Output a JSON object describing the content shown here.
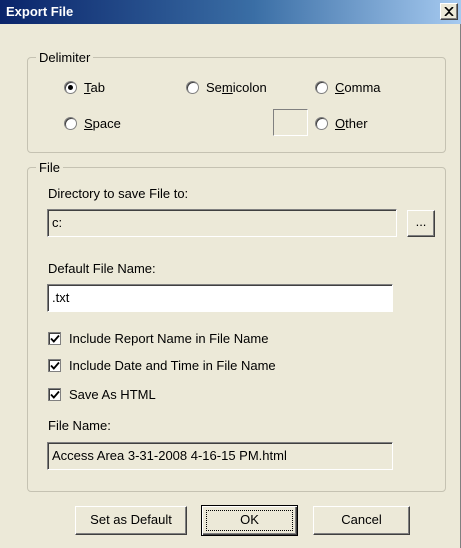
{
  "window": {
    "title": "Export File",
    "close_glyph": "X"
  },
  "delimiter": {
    "legend": "Delimiter",
    "options": [
      {
        "id": "tab",
        "pre": "",
        "accel": "T",
        "post": "ab",
        "selected": true
      },
      {
        "id": "semicolon",
        "pre": "Se",
        "accel": "m",
        "post": "icolon",
        "selected": false
      },
      {
        "id": "comma",
        "pre": "",
        "accel": "C",
        "post": "omma",
        "selected": false
      },
      {
        "id": "space",
        "pre": "",
        "accel": "S",
        "post": "pace",
        "selected": false
      },
      {
        "id": "other",
        "pre": "",
        "accel": "O",
        "post": "ther",
        "selected": false
      }
    ],
    "other_value": ""
  },
  "file": {
    "legend": "File",
    "directory_label": "Directory to save File to:",
    "directory_value": "c:",
    "browse_label": "...",
    "default_name_label": "Default File Name:",
    "default_name_value": ".txt",
    "checkboxes": [
      {
        "id": "include-report-name",
        "label": "Include Report Name in File Name",
        "checked": true
      },
      {
        "id": "include-date-time",
        "label": "Include Date and Time in File Name",
        "checked": true
      },
      {
        "id": "save-as-html",
        "label": "Save As HTML",
        "checked": true
      }
    ],
    "file_name_label": "File Name:",
    "file_name_value": "Access Area 3-31-2008 4-16-15 PM.html"
  },
  "buttons": {
    "set_default": "Set as Default",
    "ok": "OK",
    "cancel": "Cancel"
  }
}
